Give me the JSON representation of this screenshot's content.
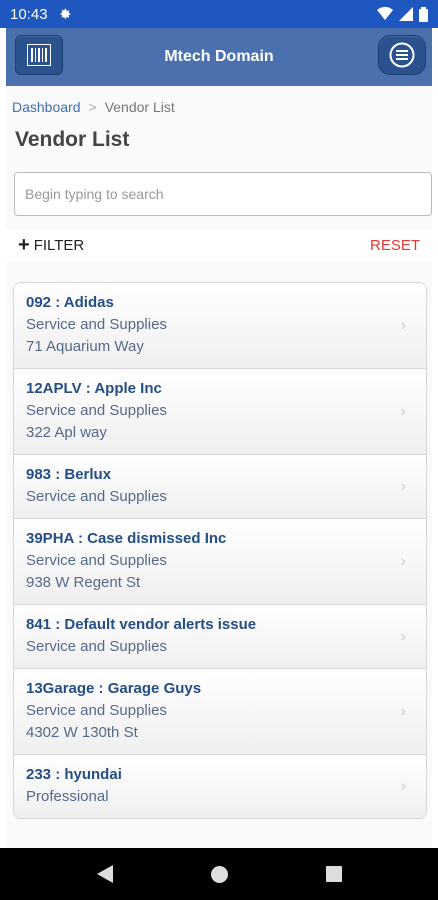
{
  "status": {
    "time": "10:43"
  },
  "header": {
    "title": "Mtech Domain"
  },
  "breadcrumb": {
    "home": "Dashboard",
    "sep": ">",
    "current": "Vendor List"
  },
  "page_title": "Vendor List",
  "search": {
    "placeholder": "Begin typing to search",
    "value": ""
  },
  "filter": {
    "label": "FILTER",
    "reset": "RESET"
  },
  "vendors": [
    {
      "name": "092 : Adidas",
      "category": "Service and Supplies",
      "address": "71 Aquarium Way"
    },
    {
      "name": "12APLV : Apple Inc",
      "category": "Service and Supplies",
      "address": "322 Apl way"
    },
    {
      "name": "983 : Berlux",
      "category": "Service and Supplies"
    },
    {
      "name": "39PHA : Case dismissed Inc",
      "category": "Service and Supplies",
      "address": "938 W Regent St"
    },
    {
      "name": "841 : Default vendor alerts issue",
      "category": "Service and Supplies"
    },
    {
      "name": "13Garage : Garage Guys",
      "category": "Service and Supplies",
      "address": "4302 W 130th St"
    },
    {
      "name": "233 : hyundai",
      "category": "Professional"
    }
  ],
  "icons": {
    "status": [
      "gear-icon",
      "wifi-icon",
      "signal-icon",
      "battery-icon"
    ],
    "header_left": "barcode-icon",
    "header_right": "menu-icon",
    "row": "chevron-right-icon",
    "nav": [
      "back-icon",
      "home-icon",
      "recents-icon"
    ]
  },
  "colors": {
    "status_bar": "#1f57c1",
    "header": "#4a71ad",
    "vendor_name": "#254e85",
    "reset": "#e53935"
  }
}
